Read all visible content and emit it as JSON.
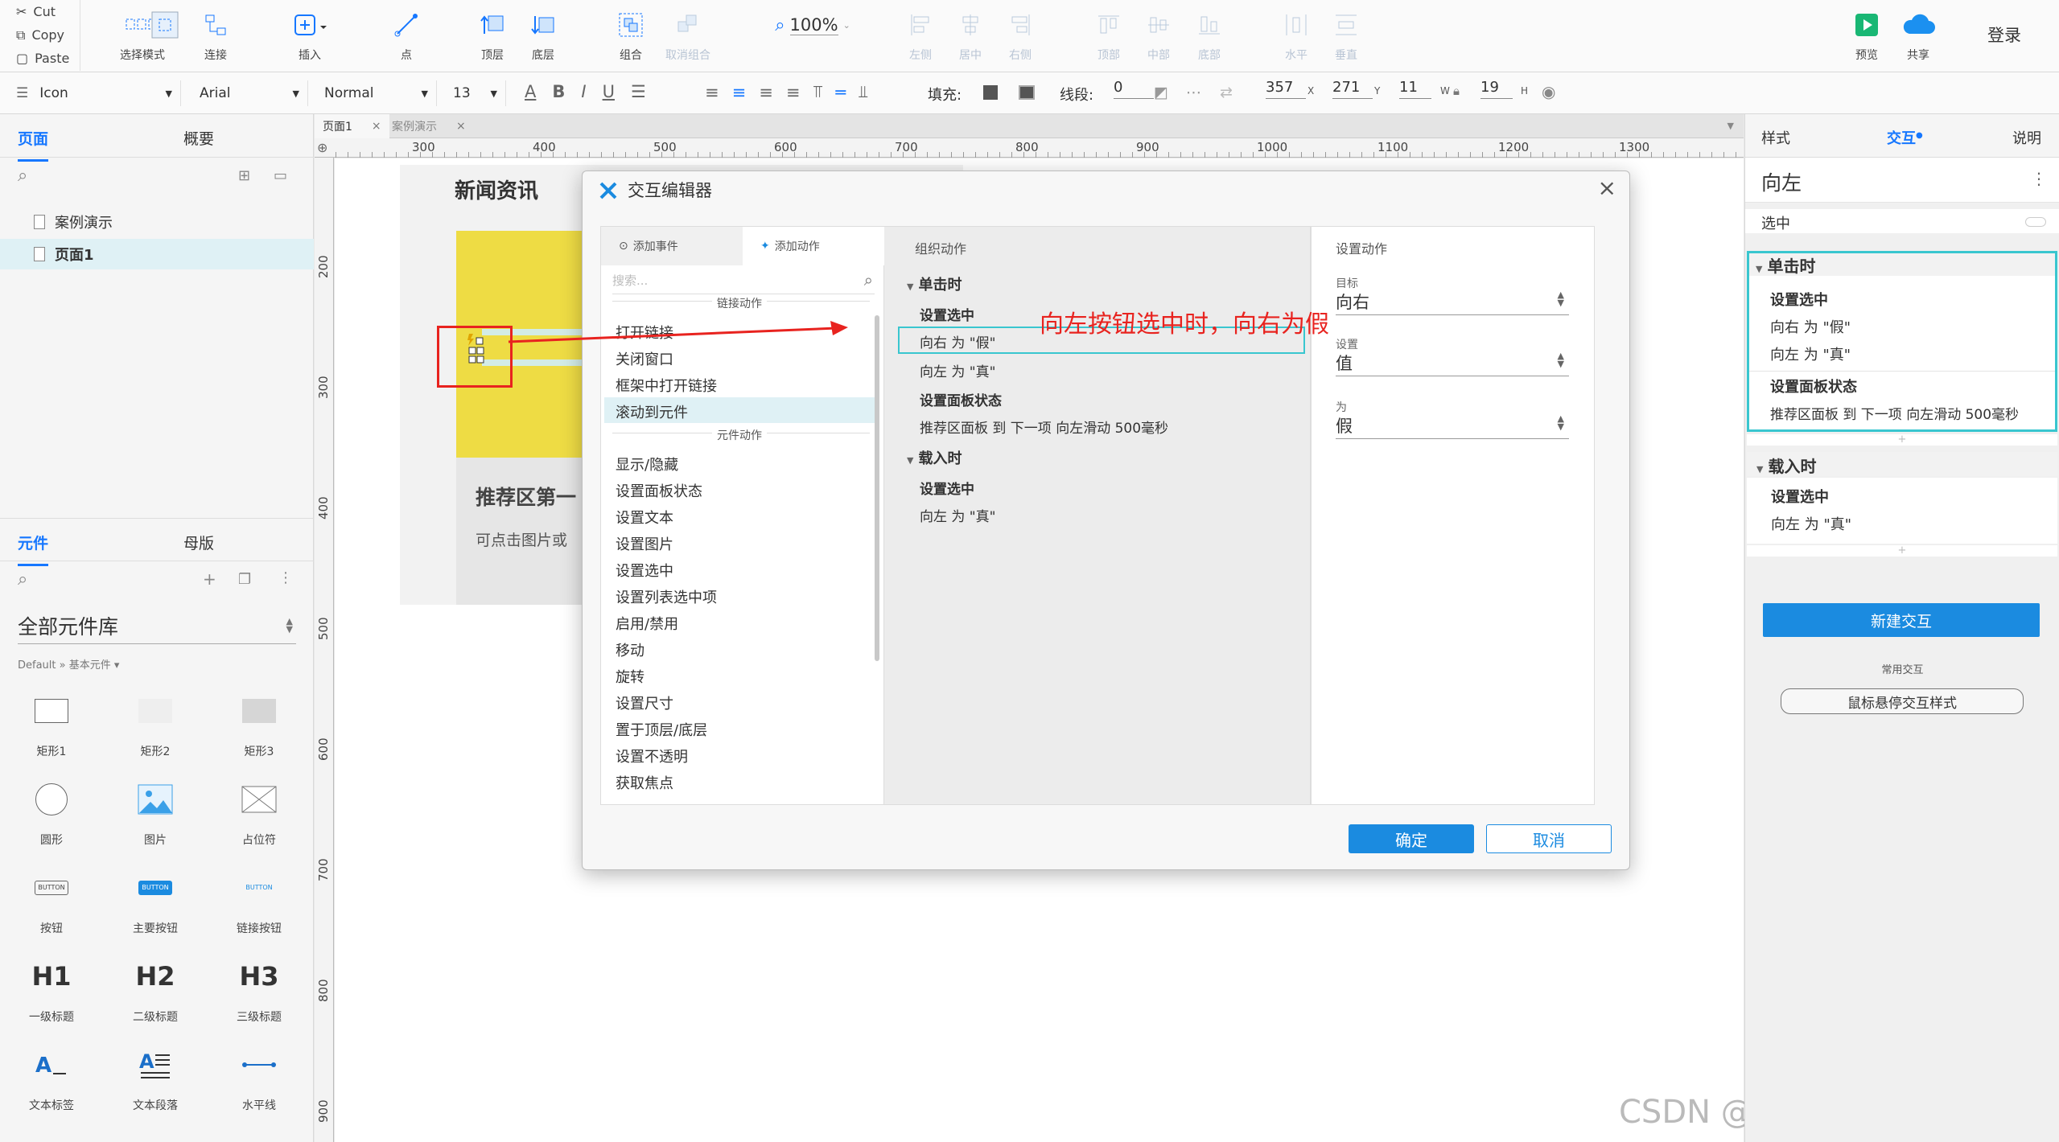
{
  "toolbar": {
    "clipboard": [
      "Cut",
      "Copy",
      "Paste"
    ],
    "tools": [
      {
        "label": "选择模式",
        "icon": "select-mode-icon"
      },
      {
        "label": "连接",
        "icon": "connect-icon"
      },
      {
        "label": "插入",
        "icon": "insert-icon"
      },
      {
        "label": "点",
        "icon": "point-icon"
      },
      {
        "label": "顶层",
        "icon": "bring-front-icon"
      },
      {
        "label": "底层",
        "icon": "send-back-icon"
      },
      {
        "label": "组合",
        "icon": "group-icon"
      },
      {
        "label": "取消组合",
        "icon": "ungroup-icon"
      },
      {
        "label": "左侧",
        "icon": "align-left-icon"
      },
      {
        "label": "居中",
        "icon": "align-center-icon"
      },
      {
        "label": "右侧",
        "icon": "align-right-icon"
      },
      {
        "label": "顶部",
        "icon": "align-top-icon"
      },
      {
        "label": "中部",
        "icon": "align-middle-icon"
      },
      {
        "label": "底部",
        "icon": "align-bottom-icon"
      },
      {
        "label": "水平",
        "icon": "distribute-h-icon"
      },
      {
        "label": "垂直",
        "icon": "distribute-v-icon"
      }
    ],
    "zoom": "100%",
    "preview": "预览",
    "share": "共享",
    "login": "登录"
  },
  "format": {
    "style": "Icon",
    "font": "Arial",
    "weight": "Normal",
    "size": "13",
    "fill_label": "填充:",
    "stroke_label": "线段:",
    "stroke_value": "0",
    "x": "357",
    "x_unit": "X",
    "y": "271",
    "y_unit": "Y",
    "w": "11",
    "w_unit": "W",
    "h": "19",
    "h_unit": "H"
  },
  "left": {
    "tab_pages": "页面",
    "tab_outline": "概要",
    "pages": [
      "案例演示",
      "页面1"
    ],
    "tab_widgets": "元件",
    "tab_masters": "母版",
    "library": "全部元件库",
    "library_path": "Default » 基本元件 ▾",
    "widgets": [
      "矩形1",
      "矩形2",
      "矩形3",
      "圆形",
      "图片",
      "占位符",
      "按钮",
      "主要按钮",
      "链接按钮",
      "一级标题",
      "二级标题",
      "三级标题",
      "文本标签",
      "文本段落",
      "水平线"
    ],
    "widget_glyphs": {
      "button": "BUTTON",
      "h1": "H1",
      "h2": "H2",
      "h3": "H3"
    }
  },
  "canvas": {
    "tabs": [
      "页面1",
      "案例演示"
    ],
    "hruler": [
      "300",
      "400",
      "500",
      "600",
      "700",
      "800",
      "900",
      "1000",
      "1100",
      "1200",
      "1300"
    ],
    "vruler": [
      "200",
      "300",
      "400",
      "500",
      "600",
      "700",
      "800",
      "900"
    ],
    "news_title": "新闻资讯",
    "recommend_title": "推荐区第一",
    "recommend_sub": "可点击图片或",
    "annotation": "向左按钮选中时，向右为假",
    "watermark": "CSDN @结构化知识课堂"
  },
  "dialog": {
    "title": "交互编辑器",
    "tab_add_event": "添加事件",
    "tab_add_action": "添加动作",
    "search_placeholder": "搜索...",
    "section_link": "链接动作",
    "link_actions": [
      "打开链接",
      "关闭窗口",
      "框架中打开链接",
      "滚动到元件"
    ],
    "section_widget": "元件动作",
    "widget_actions": [
      "显示/隐藏",
      "设置面板状态",
      "设置文本",
      "设置图片",
      "设置选中",
      "设置列表选中项",
      "启用/禁用",
      "移动",
      "旋转",
      "设置尺寸",
      "置于顶层/底层",
      "设置不透明",
      "获取焦点"
    ],
    "org_title": "组织动作",
    "click_event": "单击时",
    "set_selected": "设置选中",
    "org_item1": "向右 为 \"假\"",
    "org_item2": "向左 为 \"真\"",
    "set_panel": "设置面板状态",
    "panel_item": "推荐区面板 到 下一项 向左滑动 500毫秒",
    "load_event": "载入时",
    "load_set_selected": "设置选中",
    "load_item": "向左 为 \"真\"",
    "config_title": "设置动作",
    "target_label": "目标",
    "target_value": "向右",
    "set_label": "设置",
    "set_value": "值",
    "to_label": "为",
    "to_value": "假",
    "ok": "确定",
    "cancel": "取消"
  },
  "right": {
    "tab_style": "样式",
    "tab_interact": "交互",
    "tab_notes": "说明",
    "element_name": "向左",
    "selected_label": "选中",
    "click_event": "单击时",
    "set_selected": "设置选中",
    "item1": "向右 为 \"假\"",
    "item2": "向左 为 \"真\"",
    "set_panel": "设置面板状态",
    "panel_item": "推荐区面板 到 下一项 向左滑动 500毫秒",
    "load_event": "载入时",
    "load_set_selected": "设置选中",
    "load_item": "向左 为 \"真\"",
    "new_interaction": "新建交互",
    "common_label": "常用交互",
    "hover_style": "鼠标悬停交互样式"
  },
  "colors": {
    "accent": "#1677ff",
    "annotation": "#e8231f",
    "highlight": "#39c6cf",
    "yellow": "#eedc44"
  }
}
